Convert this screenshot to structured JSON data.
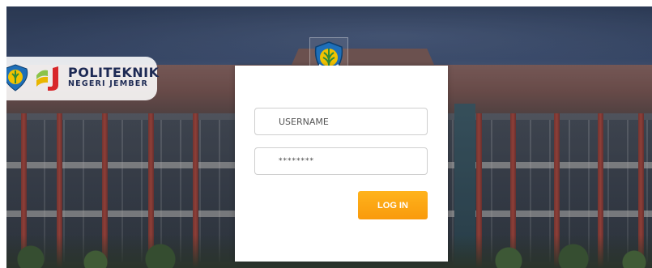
{
  "brand": {
    "title": "POLITEKNIK",
    "subtitle": "NEGERI JEMBER"
  },
  "login": {
    "username_placeholder": "USERNAME",
    "password_value": "********",
    "submit_label": "LOG IN"
  },
  "colors": {
    "accent": "#f99a0c",
    "brand_navy": "#1d2a54",
    "emblem_blue": "#1e6fb8",
    "emblem_yellow": "#f2c200",
    "emblem_green": "#2e8b3a"
  },
  "icons": {
    "campus_emblem": "polije-emblem-icon",
    "brand_mark": "polije-logo-mark-icon"
  }
}
